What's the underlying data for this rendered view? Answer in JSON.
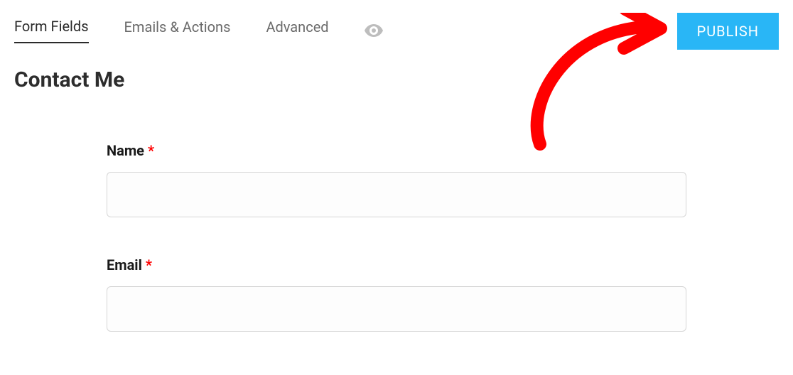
{
  "tabs": {
    "form_fields": "Form Fields",
    "emails_actions": "Emails & Actions",
    "advanced": "Advanced"
  },
  "publish_button": "PUBLISH",
  "page_title": "Contact Me",
  "fields": {
    "name": {
      "label": "Name",
      "required": "*",
      "value": ""
    },
    "email": {
      "label": "Email",
      "required": "*",
      "value": ""
    }
  },
  "colors": {
    "accent": "#29b6f6",
    "required": "#ff0000",
    "annotation": "#ff0000"
  }
}
